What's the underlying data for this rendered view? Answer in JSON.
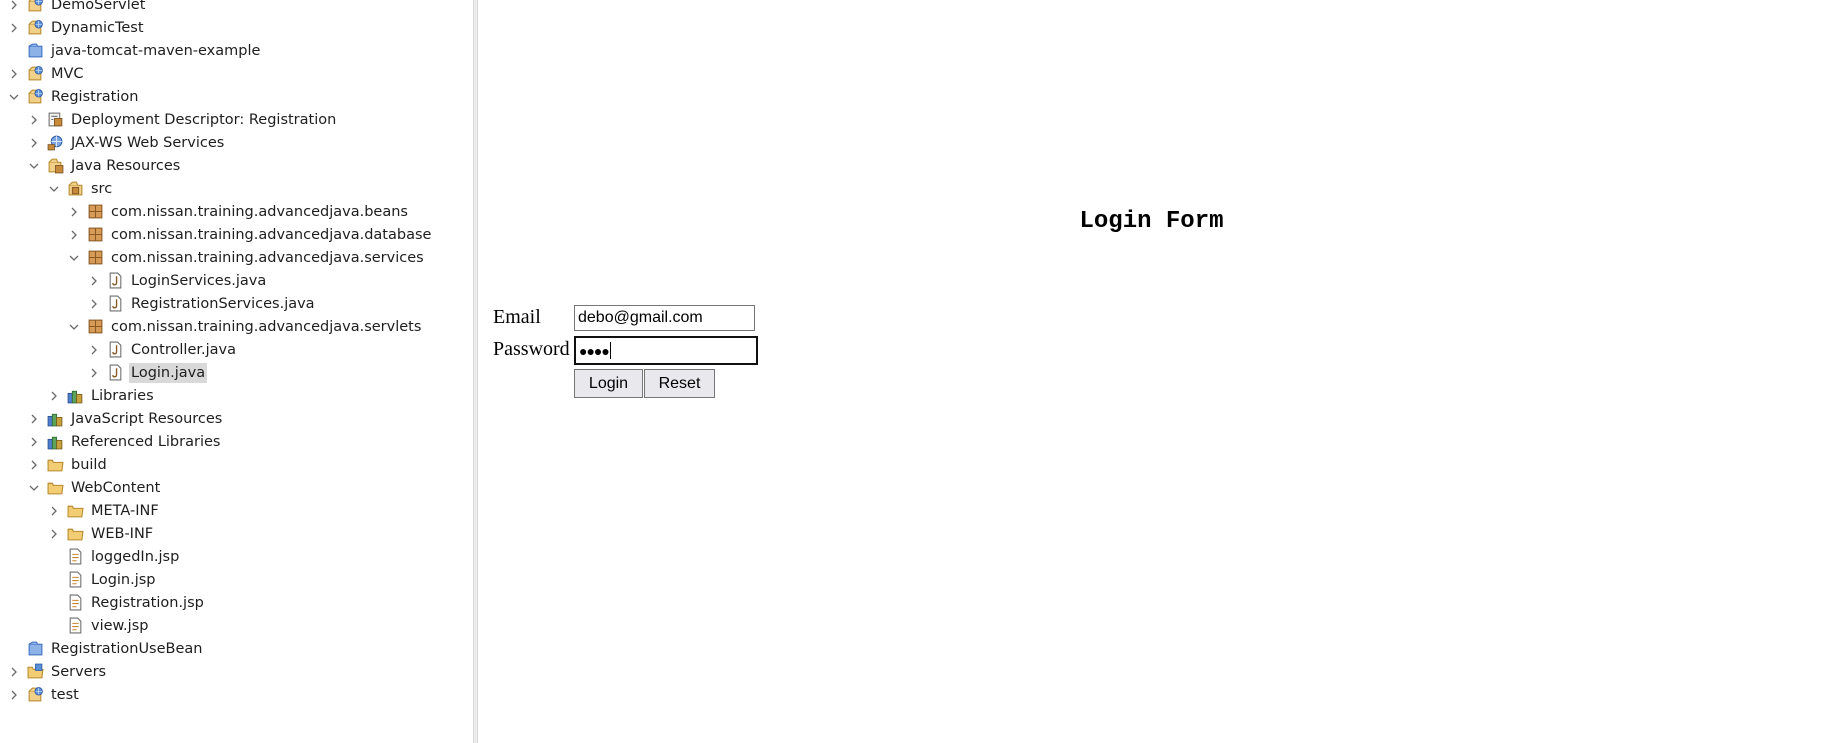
{
  "explorer": {
    "items": [
      {
        "label": "DemoServlet",
        "icon": "web-project-icon",
        "twisty": "collapsed",
        "selected": false
      },
      {
        "label": "DynamicTest",
        "icon": "web-project-icon",
        "twisty": "collapsed",
        "selected": false
      },
      {
        "label": "java-tomcat-maven-example",
        "icon": "closed-project-icon",
        "twisty": "none",
        "selected": false
      },
      {
        "label": "MVC",
        "icon": "web-project-icon",
        "twisty": "collapsed",
        "selected": false
      },
      {
        "label": "Registration",
        "icon": "web-project-icon",
        "twisty": "expanded",
        "selected": false
      },
      {
        "label": "Deployment Descriptor: Registration",
        "icon": "deployment-descriptor-icon",
        "twisty": "collapsed",
        "selected": false
      },
      {
        "label": "JAX-WS Web Services",
        "icon": "web-services-icon",
        "twisty": "collapsed",
        "selected": false
      },
      {
        "label": "Java Resources",
        "icon": "java-resources-icon",
        "twisty": "expanded",
        "selected": false
      },
      {
        "label": "src",
        "icon": "source-folder-icon",
        "twisty": "expanded",
        "selected": false
      },
      {
        "label": "com.nissan.training.advancedjava.beans",
        "icon": "package-icon",
        "twisty": "collapsed",
        "selected": false
      },
      {
        "label": "com.nissan.training.advancedjava.database",
        "icon": "package-icon",
        "twisty": "collapsed",
        "selected": false
      },
      {
        "label": "com.nissan.training.advancedjava.services",
        "icon": "package-icon",
        "twisty": "expanded",
        "selected": false
      },
      {
        "label": "LoginServices.java",
        "icon": "java-file-icon",
        "twisty": "collapsed",
        "selected": false
      },
      {
        "label": "RegistrationServices.java",
        "icon": "java-file-icon",
        "twisty": "collapsed",
        "selected": false
      },
      {
        "label": "com.nissan.training.advancedjava.servlets",
        "icon": "package-icon",
        "twisty": "expanded",
        "selected": false
      },
      {
        "label": "Controller.java",
        "icon": "java-file-icon",
        "twisty": "collapsed",
        "selected": false
      },
      {
        "label": "Login.java",
        "icon": "java-file-icon",
        "twisty": "collapsed",
        "selected": true
      },
      {
        "label": "Libraries",
        "icon": "libraries-icon",
        "twisty": "collapsed",
        "selected": false
      },
      {
        "label": "JavaScript Resources",
        "icon": "libraries-icon",
        "twisty": "collapsed",
        "selected": false
      },
      {
        "label": "Referenced Libraries",
        "icon": "libraries-icon",
        "twisty": "collapsed",
        "selected": false
      },
      {
        "label": "build",
        "icon": "folder-icon",
        "twisty": "collapsed",
        "selected": false
      },
      {
        "label": "WebContent",
        "icon": "folder-icon",
        "twisty": "expanded",
        "selected": false
      },
      {
        "label": "META-INF",
        "icon": "folder-icon",
        "twisty": "collapsed",
        "selected": false
      },
      {
        "label": "WEB-INF",
        "icon": "folder-icon",
        "twisty": "collapsed",
        "selected": false
      },
      {
        "label": "loggedIn.jsp",
        "icon": "jsp-file-icon",
        "twisty": "none",
        "selected": false
      },
      {
        "label": "Login.jsp",
        "icon": "jsp-file-icon",
        "twisty": "none",
        "selected": false
      },
      {
        "label": "Registration.jsp",
        "icon": "jsp-file-icon",
        "twisty": "none",
        "selected": false
      },
      {
        "label": "view.jsp",
        "icon": "jsp-file-icon",
        "twisty": "none",
        "selected": false
      },
      {
        "label": "RegistrationUseBean",
        "icon": "closed-project-icon",
        "twisty": "none",
        "selected": false
      },
      {
        "label": "Servers",
        "icon": "servers-folder-icon",
        "twisty": "collapsed",
        "selected": false
      },
      {
        "label": "test",
        "icon": "web-project-icon",
        "twisty": "collapsed",
        "selected": false
      }
    ]
  },
  "login_form": {
    "title": "Login Form",
    "email_label": "Email",
    "email_value": "debo@gmail.com",
    "password_label": "Password",
    "password_value": "●●●●",
    "login_button": "Login",
    "reset_button": "Reset"
  },
  "colors": {
    "selection": "#d9d9d9",
    "package": "#b9742f",
    "folder": "#e6b552",
    "project_blue": "#4a74c9"
  }
}
